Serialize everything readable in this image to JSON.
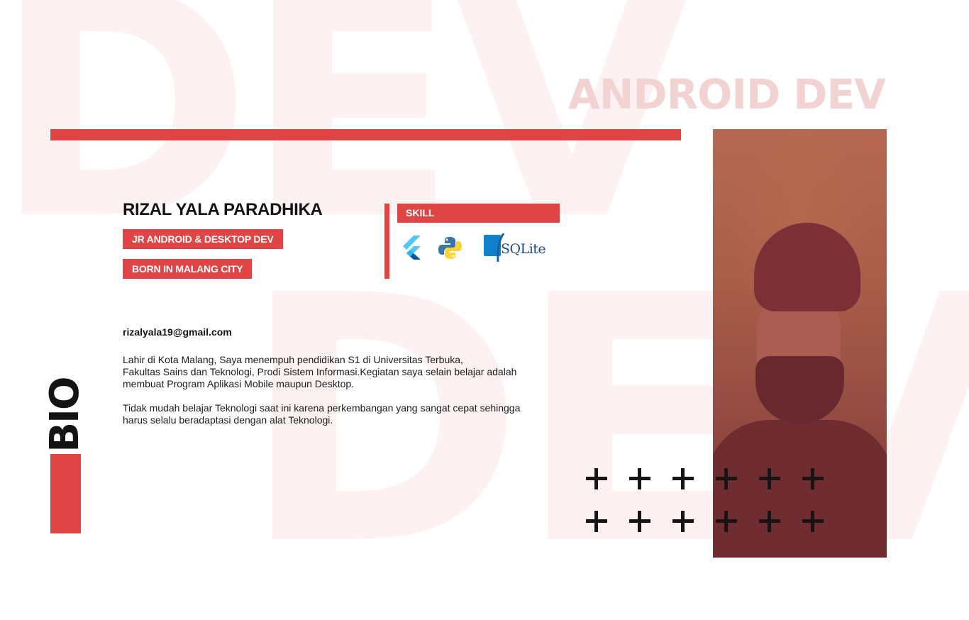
{
  "background": {
    "top_word": "DEV",
    "bottom_word": "DEV"
  },
  "headline": "ANDROID DEV",
  "profile": {
    "name": "RIZAL YALA PARADHIKA",
    "role_tag": "JR ANDROID & DESKTOP DEV",
    "born_tag": "BORN IN MALANG CITY"
  },
  "skills": {
    "title": "SKILL",
    "items": [
      {
        "icon": "flutter-icon"
      },
      {
        "icon": "python-icon"
      },
      {
        "icon": "sqlite-icon",
        "label": "SQLite"
      }
    ]
  },
  "contact": {
    "email": "rizalyala19@gmail.com"
  },
  "bio": {
    "section_label": "BIO",
    "paragraph_1_lines": [
      "Lahir di Kota Malang, Saya menempuh pendidikan S1 di Universitas Terbuka,",
      "Fakultas Sains dan Teknologi, Prodi Sistem Informasi.Kegiatan saya selain belajar adalah",
      "membuat Program Aplikasi Mobile maupun Desktop."
    ],
    "paragraph_2_lines": [
      "Tidak mudah belajar Teknologi saat ini karena perkembangan yang sangat cepat sehingga",
      "harus selalu beradaptasi dengan alat Teknologi."
    ]
  },
  "decor": {
    "plus_rows": 2,
    "plus_cols": 6,
    "plus_color": "#151515"
  },
  "colors": {
    "accent": "#e04545",
    "headline": "#f3d2d2",
    "background_word": "#fdf1f1",
    "text": "#141414"
  }
}
